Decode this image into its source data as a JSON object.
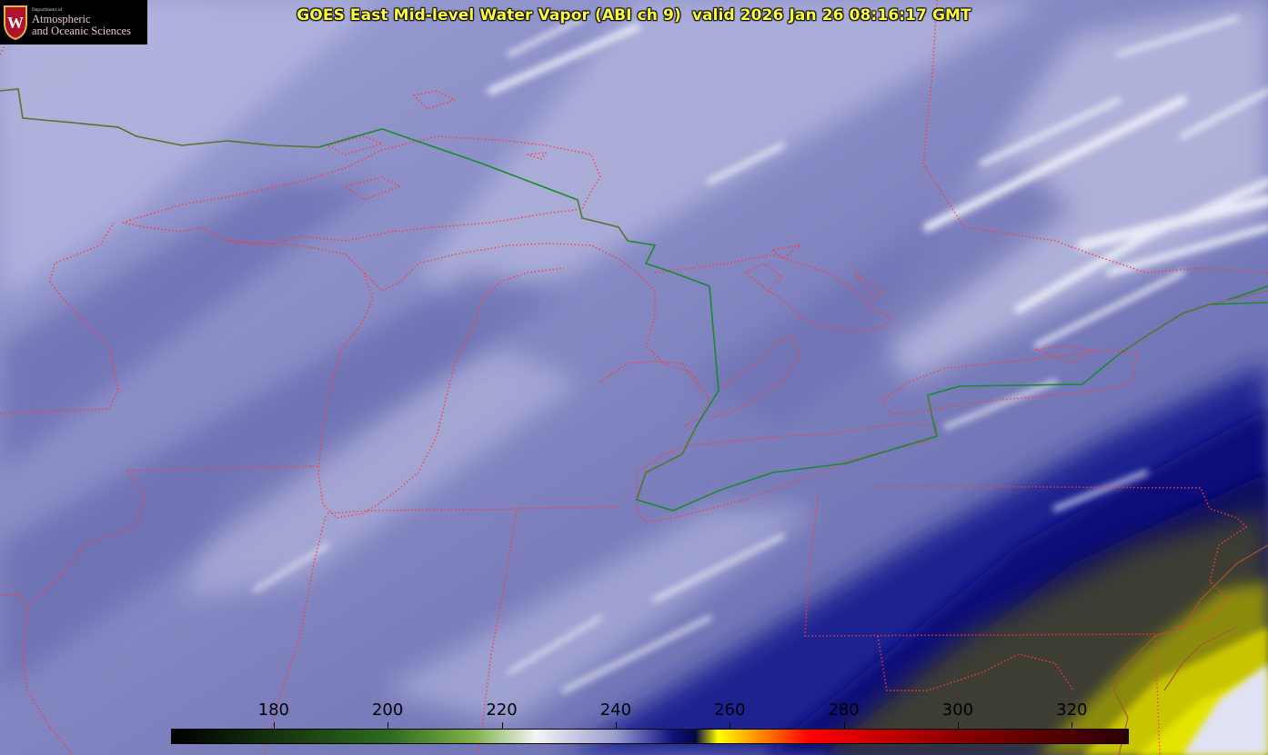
{
  "logo": {
    "dept_small": "Department of",
    "line1": "Atmospheric",
    "line2": "and Oceanic Sciences",
    "crest_letter": "W",
    "crest_icon": "university-crest-icon",
    "colors": {
      "background": "#000000",
      "crest_red": "#b0122b",
      "crest_gold": "#d9b84a",
      "text": "#e6c7c7"
    }
  },
  "title": {
    "text": "GOES East Mid-level Water Vapor (ABI ch 9)  valid 2026 Jan 26 08:16:17 GMT",
    "color": "#ffff3c"
  },
  "colorbar": {
    "ticks": [
      {
        "label": "180",
        "value": 180
      },
      {
        "label": "200",
        "value": 200
      },
      {
        "label": "220",
        "value": 220
      },
      {
        "label": "240",
        "value": 240
      },
      {
        "label": "260",
        "value": 260
      },
      {
        "label": "280",
        "value": 280
      },
      {
        "label": "300",
        "value": 300
      },
      {
        "label": "320",
        "value": 320
      }
    ],
    "range": [
      162,
      330
    ],
    "stops": [
      {
        "value": 162,
        "color": "#000000"
      },
      {
        "value": 200,
        "color": "#2d6a1f"
      },
      {
        "value": 215,
        "color": "#7fb04a"
      },
      {
        "value": 226,
        "color": "#f4f4f4"
      },
      {
        "value": 240,
        "color": "#9a9dd0"
      },
      {
        "value": 250,
        "color": "#101080"
      },
      {
        "value": 254,
        "color": "#050540"
      },
      {
        "value": 258,
        "color": "#ffff00"
      },
      {
        "value": 266,
        "color": "#ff8000"
      },
      {
        "value": 274,
        "color": "#ff0000"
      },
      {
        "value": 300,
        "color": "#8a0000"
      },
      {
        "value": 330,
        "color": "#2a0000"
      }
    ]
  },
  "map": {
    "colors": {
      "background": "#8c8fc4",
      "moist_band": "#0c0c78",
      "dry_warm": "#c8c800",
      "cold_cloud": "#e6e8f5",
      "boundary": "#ff3a3a",
      "international_border": "#1a8a2a"
    },
    "layers": [
      "state-borders",
      "lake-shorelines",
      "coastline",
      "us-canada-border",
      "water-vapor-imagery"
    ]
  }
}
